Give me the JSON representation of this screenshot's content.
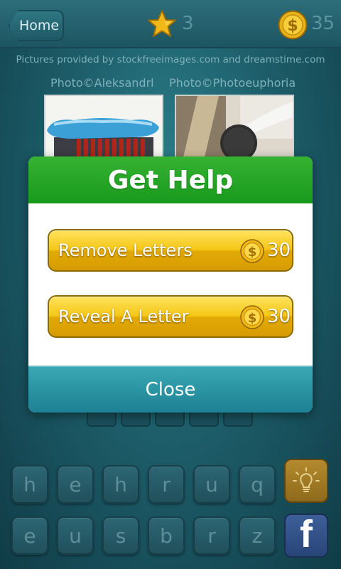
{
  "header": {
    "home_label": "Home",
    "stars": "3",
    "coins": "35"
  },
  "credits": {
    "pictures": "Pictures provided by stockfreeimages.com and dreamstime.com",
    "photo_left": "Photo©Aleksandrl",
    "photo_right": "Photo©Photoeuphoria"
  },
  "dialog": {
    "title": "Get Help",
    "options": [
      {
        "label": "Remove Letters",
        "cost": "30"
      },
      {
        "label": "Reveal A Letter",
        "cost": "30"
      }
    ],
    "close_label": "Close"
  },
  "keyboard": {
    "row1": [
      "h",
      "e",
      "h",
      "r",
      "u",
      "q"
    ],
    "row2": [
      "e",
      "u",
      "s",
      "b",
      "r",
      "z"
    ],
    "hint_icon": "lightbulb-icon",
    "share_icon": "facebook-icon",
    "share_glyph": "f"
  },
  "colors": {
    "accent_green": "#189a1c",
    "gold": "#f5c716",
    "teal": "#1d8194"
  }
}
